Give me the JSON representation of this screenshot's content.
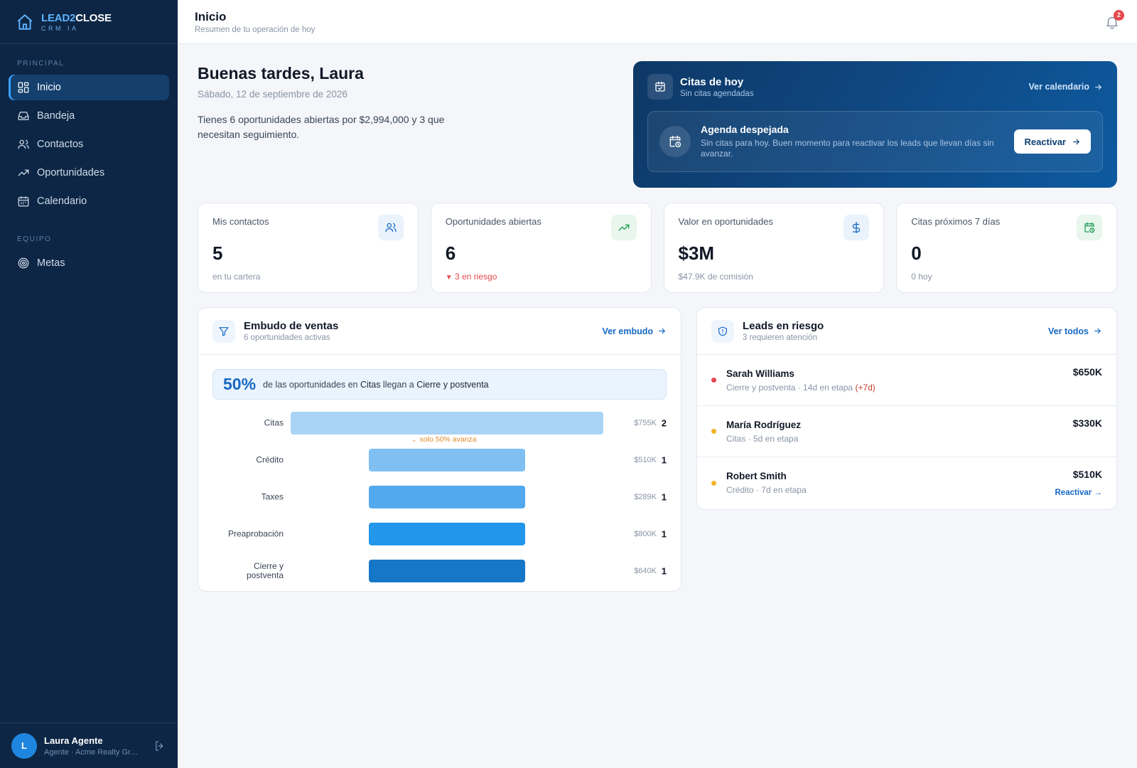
{
  "brand": {
    "name_a": "LEAD2",
    "name_b": "CLOSE",
    "tagline": "CRM IA"
  },
  "sidebar": {
    "section_principal": "PRINCIPAL",
    "items": [
      {
        "label": "Inicio",
        "icon": "grid-icon"
      },
      {
        "label": "Bandeja",
        "icon": "inbox-icon"
      },
      {
        "label": "Contactos",
        "icon": "users-icon"
      },
      {
        "label": "Oportunidades",
        "icon": "trend-icon"
      },
      {
        "label": "Calendario",
        "icon": "calendar-icon"
      }
    ],
    "section_equipo": "EQUIPO",
    "team_items": [
      {
        "label": "Metas",
        "icon": "target-icon"
      }
    ]
  },
  "user": {
    "initial": "L",
    "name": "Laura Agente",
    "role": "Agente · Acme Realty Group"
  },
  "topbar": {
    "title": "Inicio",
    "subtitle": "Resumen de tu operación de hoy",
    "notifications": "2"
  },
  "greeting": {
    "title": "Buenas tardes, Laura",
    "date": "Sábado, 12 de septiembre de 2026",
    "summary": "Tienes 6 oportunidades abiertas por $2,994,000 y 3 que necesitan seguimiento."
  },
  "appointments": {
    "title": "Citas de hoy",
    "subtitle": "Sin citas agendadas",
    "link": "Ver calendario",
    "empty_title": "Agenda despejada",
    "empty_text": "Sin citas para hoy. Buen momento para reactivar los leads que llevan días sin avanzar.",
    "button": "Reactivar"
  },
  "stats": [
    {
      "label": "Mis contactos",
      "value": "5",
      "foot": "en tu cartera",
      "icon": "users-icon",
      "icon_bg": "#eaf3fc",
      "icon_color": "#1668c4"
    },
    {
      "label": "Oportunidades abiertas",
      "value": "6",
      "foot": "3 en riesgo",
      "icon": "trend-up-icon",
      "icon_bg": "#e8f6ee",
      "icon_color": "#1f9d55"
    },
    {
      "label": "Valor en oportunidades",
      "value": "$3M",
      "foot": "$47.9K de comisión",
      "icon": "dollar-icon",
      "icon_bg": "#eaf3fc",
      "icon_color": "#1668c4"
    },
    {
      "label": "Citas próximos 7 días",
      "value": "0",
      "foot": "0 hoy",
      "icon": "calendar-clock-icon",
      "icon_bg": "#e8f6ee",
      "icon_color": "#1f9d55"
    }
  ],
  "funnel": {
    "title": "Embudo de ventas",
    "subtitle": "6 oportunidades activas",
    "link": "Ver embudo",
    "conversion_pct": "50%",
    "conversion_text_a": "de las oportunidades en ",
    "conversion_from": "Citas",
    "conversion_text_b": " llegan a ",
    "conversion_to": "Cierre y postventa",
    "drop_note": "solo 50% avanza",
    "stages": [
      {
        "label": "Citas",
        "amount": "$755K",
        "count": "2",
        "rel": 1.0,
        "color": "#a9d4f7"
      },
      {
        "label": "Crédito",
        "amount": "$510K",
        "count": "1",
        "rel": 0.5,
        "color": "#7fbff2"
      },
      {
        "label": "Taxes",
        "amount": "$289K",
        "count": "1",
        "rel": 0.5,
        "color": "#52a9ee"
      },
      {
        "label": "Preaprobación",
        "amount": "$800K",
        "count": "1",
        "rel": 0.5,
        "color": "#2196ea"
      },
      {
        "label": "Cierre y postventa",
        "amount": "$640K",
        "count": "1",
        "rel": 0.5,
        "color": "#1677c9"
      }
    ]
  },
  "risk": {
    "title": "Leads en riesgo",
    "subtitle": "3 requieren atención",
    "link": "Ver todos",
    "leads": [
      {
        "name": "Sarah Williams",
        "meta": "Cierre y postventa · 14d en etapa",
        "warn": "(+7d)",
        "value": "$650K",
        "dot": "#e5484d",
        "action": ""
      },
      {
        "name": "María Rodríguez",
        "meta": "Citas · 5d en etapa",
        "warn": "",
        "value": "$330K",
        "dot": "#f0b429",
        "action": ""
      },
      {
        "name": "Robert Smith",
        "meta": "Crédito · 7d en etapa",
        "warn": "",
        "value": "$510K",
        "dot": "#f0b429",
        "action": "Reactivar"
      }
    ]
  }
}
